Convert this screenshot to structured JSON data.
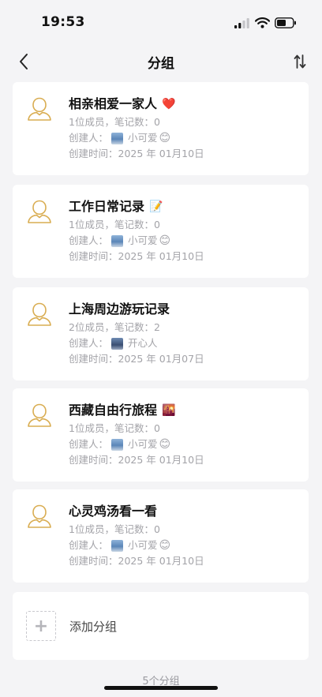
{
  "status_bar": {
    "time": "19:53"
  },
  "nav": {
    "title": "分组"
  },
  "labels": {
    "creator_prefix": "创建人：",
    "created_prefix": "创建时间："
  },
  "groups": [
    {
      "name": "相亲相爱一家人",
      "emoji": "❤️",
      "stats": "1位成员，笔记数：0",
      "creator": "小可爱",
      "creator_emoji": "😊",
      "created": "2025 年 01月10日"
    },
    {
      "name": "工作日常记录",
      "emoji": "📝",
      "stats": "1位成员，笔记数：0",
      "creator": "小可爱",
      "creator_emoji": "😊",
      "created": "2025 年 01月10日"
    },
    {
      "name": "上海周边游玩记录",
      "emoji": "",
      "stats": "2位成员，笔记数：2",
      "creator": "开心人",
      "creator_emoji": "",
      "created": "2025 年 01月07日"
    },
    {
      "name": "西藏自由行旅程",
      "emoji": "🌇",
      "stats": "1位成员，笔记数：0",
      "creator": "小可爱",
      "creator_emoji": "😊",
      "created": "2025 年 01月10日"
    },
    {
      "name": "心灵鸡汤看一看",
      "emoji": "",
      "stats": "1位成员，笔记数：0",
      "creator": "小可爱",
      "creator_emoji": "😊",
      "created": "2025 年 01月10日"
    }
  ],
  "add_group": {
    "label": "添加分组",
    "icon": "plus-icon"
  },
  "footer": {
    "count_text": "5个分组"
  },
  "colors": {
    "avatar_gold": "#d9ad52",
    "card_bg": "#ffffff",
    "page_bg": "#f4f4f6",
    "meta_text": "#a3a3a8"
  }
}
